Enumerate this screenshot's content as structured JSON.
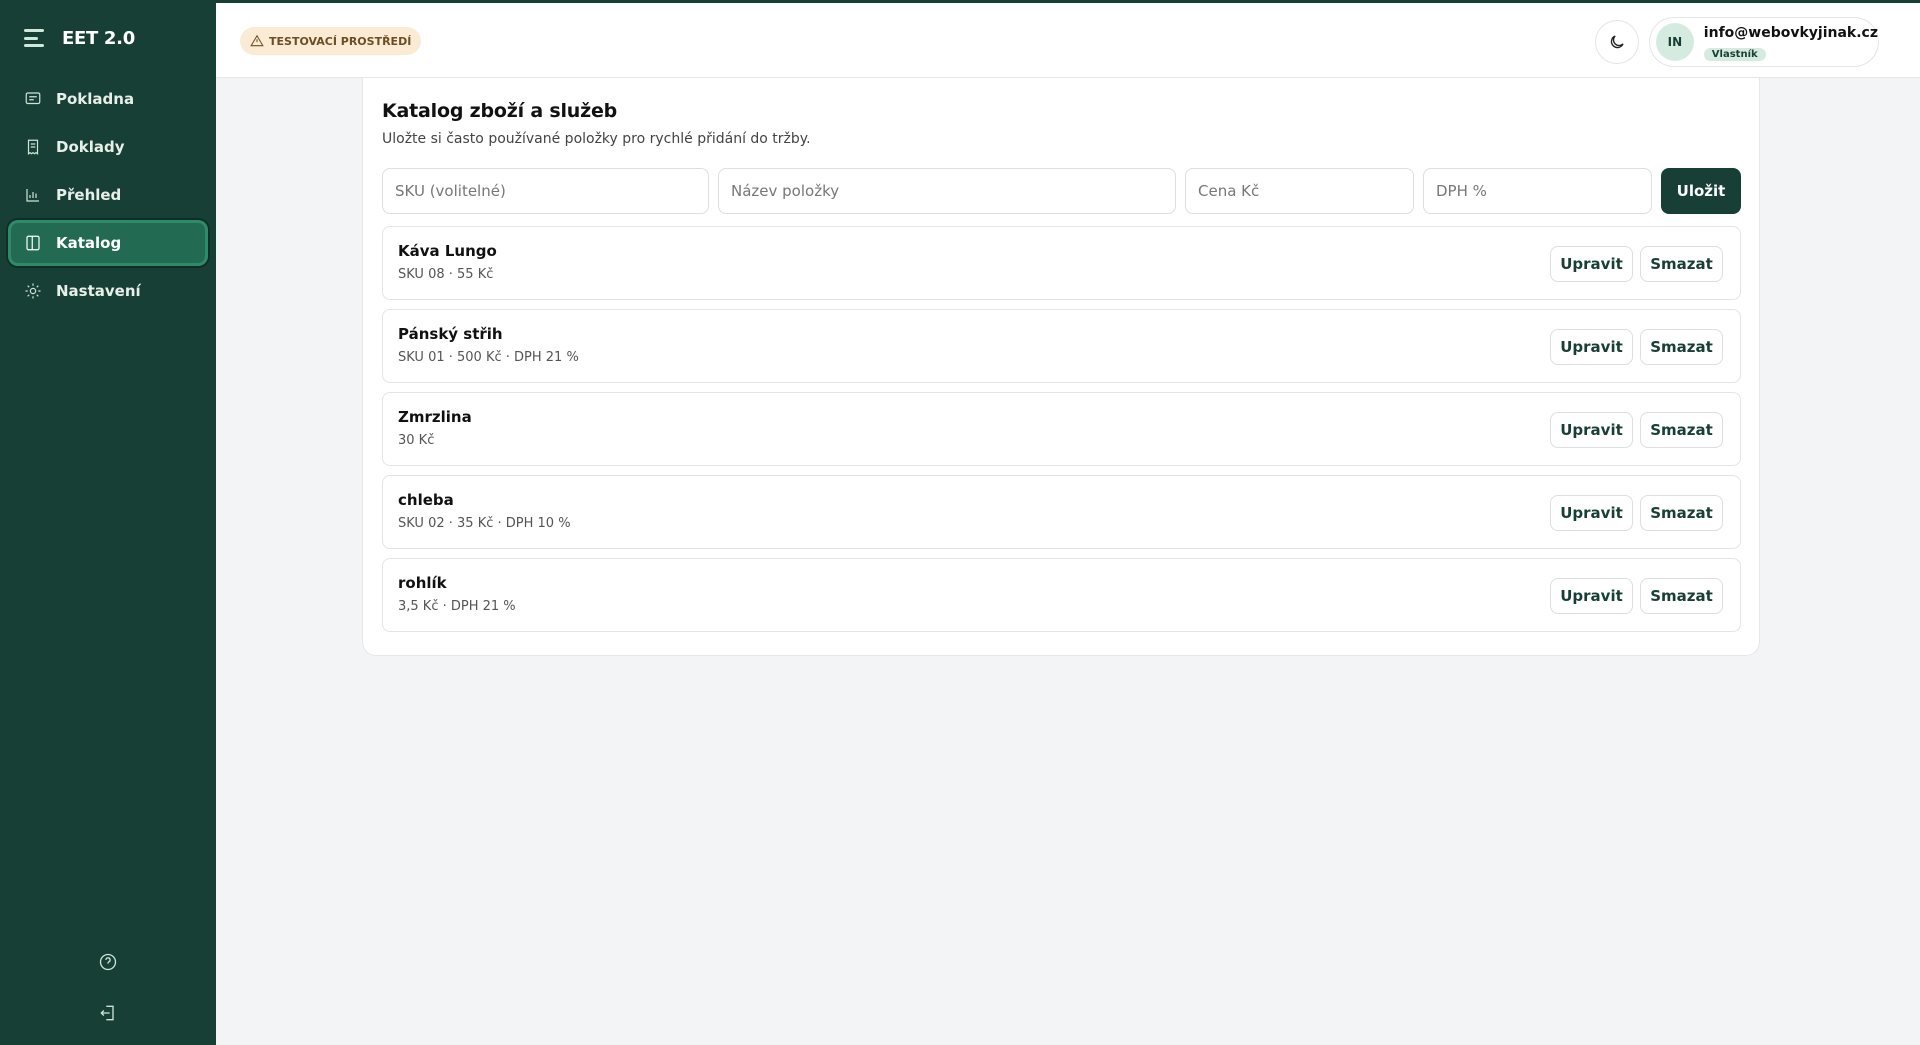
{
  "app": {
    "brand": "EET 2.0"
  },
  "sidebar": {
    "items": [
      {
        "label": "Pokladna",
        "icon": "message-square-icon"
      },
      {
        "label": "Doklady",
        "icon": "receipt-icon"
      },
      {
        "label": "Přehled",
        "icon": "bar-chart-icon"
      },
      {
        "label": "Katalog",
        "icon": "book-icon",
        "active": true
      },
      {
        "label": "Nastavení",
        "icon": "sun-gear-icon"
      }
    ],
    "bottom": [
      {
        "icon": "help-circle-icon"
      },
      {
        "icon": "log-out-icon"
      }
    ]
  },
  "header": {
    "env_badge": "TESTOVACÍ PROSTŘEDÍ",
    "theme_toggle_icon": "moon-icon",
    "user": {
      "initials": "IN",
      "email": "info@webovkyjinak.cz",
      "role": "Vlastník"
    }
  },
  "catalog": {
    "title": "Katalog zboží a služeb",
    "subtitle": "Uložte si často používané položky pro rychlé přidání do tržby.",
    "form": {
      "sku_placeholder": "SKU (volitelné)",
      "name_placeholder": "Název položky",
      "price_placeholder": "Cena Kč",
      "vat_placeholder": "DPH %",
      "save_label": "Uložit"
    },
    "edit_label": "Upravit",
    "delete_label": "Smazat",
    "items": [
      {
        "name": "Káva Lungo",
        "meta": "SKU 08 · 55 Kč"
      },
      {
        "name": "Pánský střih",
        "meta": "SKU 01 · 500 Kč · DPH 21 %"
      },
      {
        "name": "Zmrzlina",
        "meta": "30 Kč"
      },
      {
        "name": "chleba",
        "meta": "SKU 02 · 35 Kč · DPH 10 %"
      },
      {
        "name": "rohlík",
        "meta": "3,5 Kč · DPH 21 %"
      }
    ]
  },
  "colors": {
    "sidebar": "#173f35",
    "accent": "#226b52",
    "badge_bg": "#fbebd4"
  }
}
